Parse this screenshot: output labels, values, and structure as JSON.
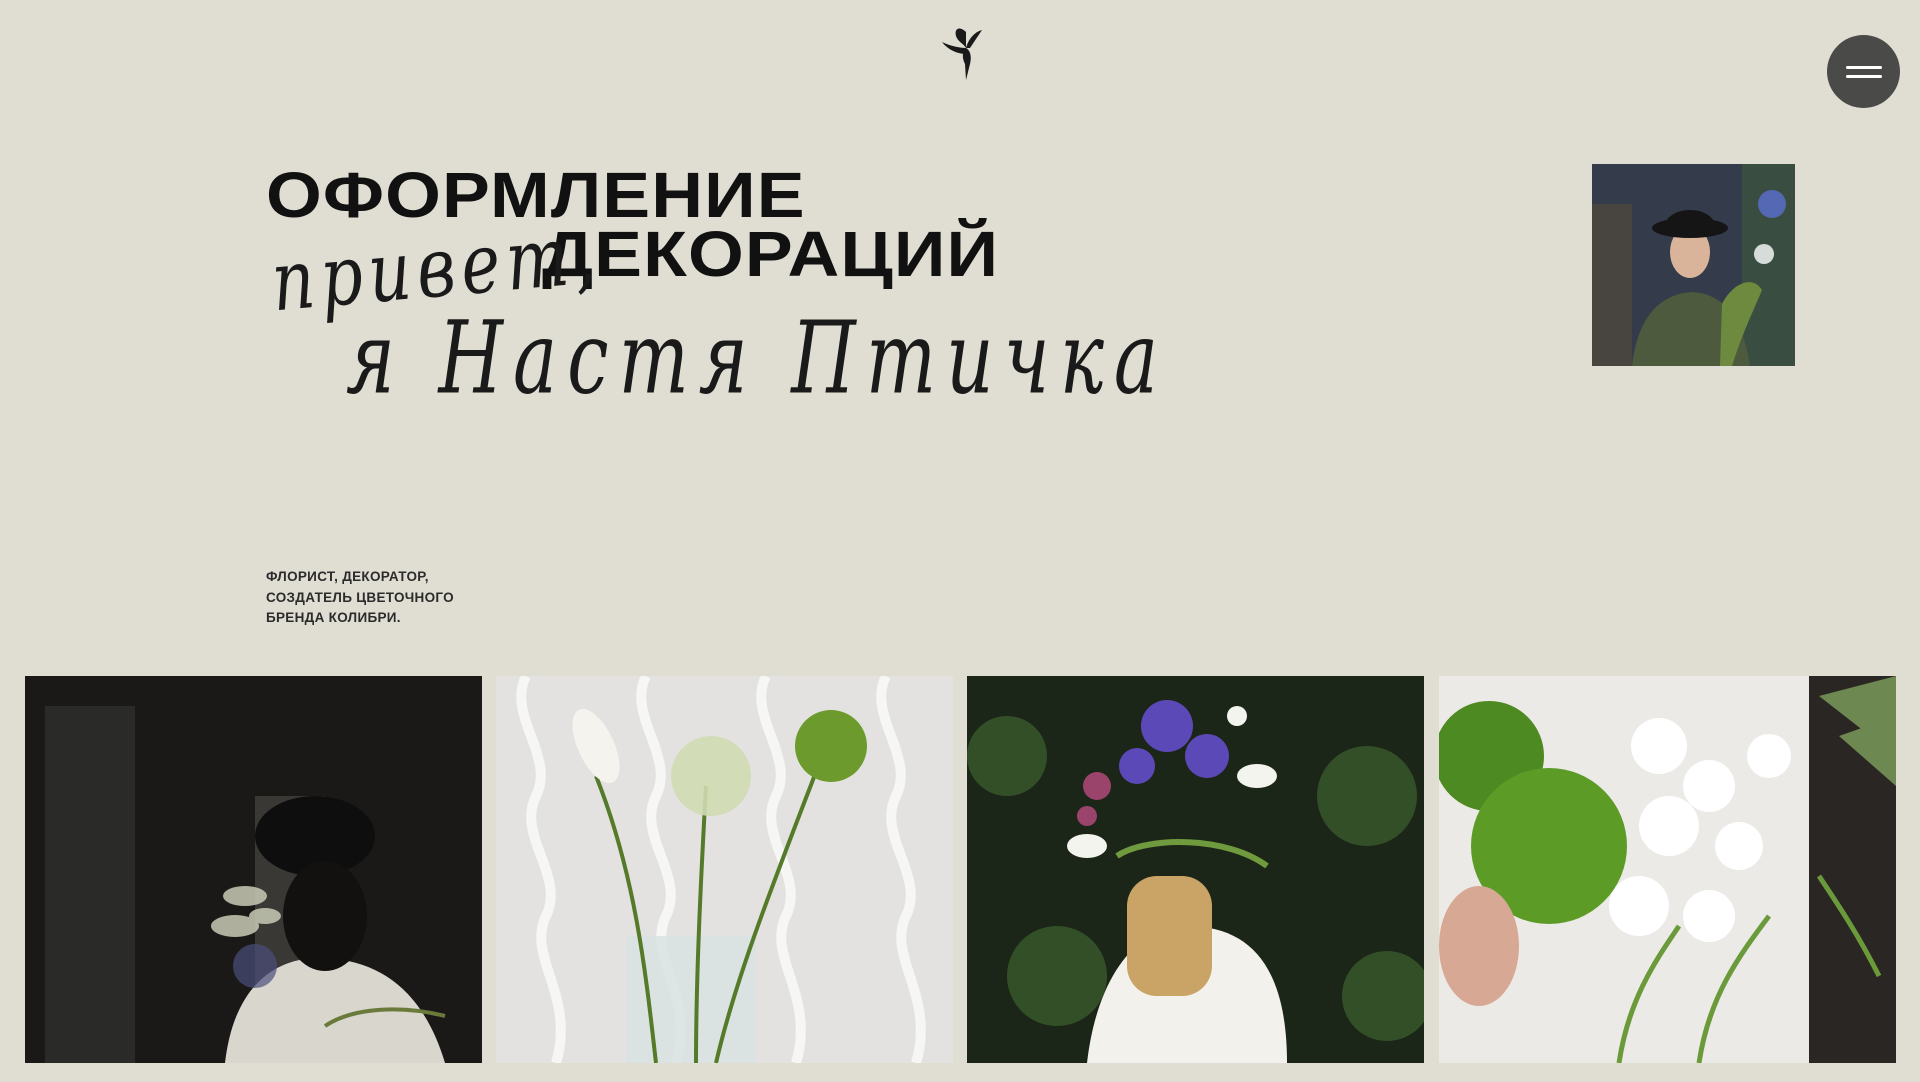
{
  "header": {
    "logo_icon": "hummingbird-logo-icon",
    "menu_icon": "hamburger-menu-icon"
  },
  "hero": {
    "headline_line1": "ОФОРМЛЕНИЕ",
    "headline_line2": "ДЕКОРАЦИЙ",
    "script_line1": "привет,",
    "script_line2": "я Настя Птичка",
    "tagline": [
      "ФЛОРИСТ, ДЕКОРАТОР,",
      "СОЗДАТЕЛЬ ЦВЕТОЧНОГО",
      "БРЕНДА КОЛИБРИ."
    ]
  },
  "colors": {
    "background": "#e0ded2",
    "text": "#141414",
    "menu_button": "#4a4a48"
  }
}
